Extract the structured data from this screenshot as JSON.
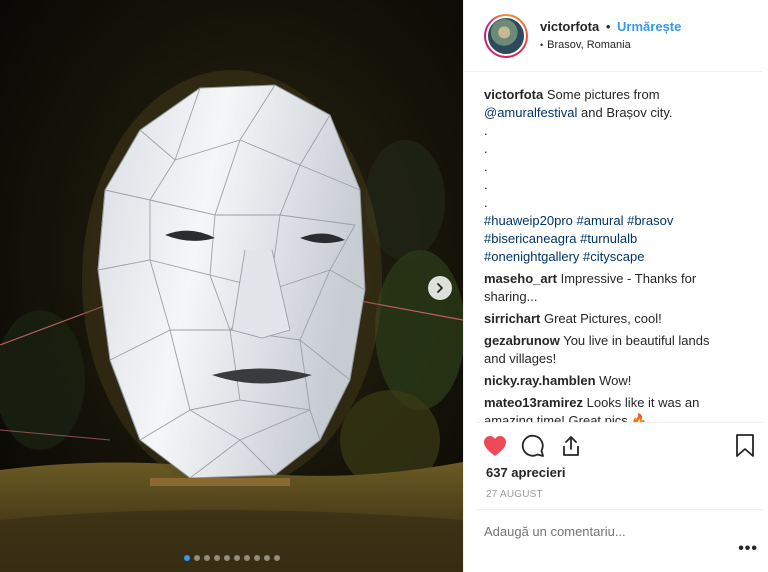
{
  "header": {
    "username": "victorfota",
    "separator": "•",
    "follow_label": "Urmărește",
    "location": "Brasov, Romania"
  },
  "caption": {
    "username": "victorfota",
    "text_before": " Some pictures from ",
    "mention": "@amuralfestival",
    "text_after": " and Brașov city.",
    "dots": [
      ".",
      ".",
      ".",
      ".",
      "."
    ],
    "hashtags_line1": "#huaweip20pro #amural #brasov",
    "hashtags_line2": "#bisericaneagra #turnulalb",
    "hashtags_line3": "#onenightgallery #cityscape"
  },
  "comments": [
    {
      "user": "maseho_art",
      "text": " Impressive - Thanks for sharing..."
    },
    {
      "user": "sirrichart",
      "text": " Great Pictures, cool!"
    },
    {
      "user": "gezabrunow",
      "text": " You live in beautiful lands and villages!"
    },
    {
      "user": "nicky.ray.hamblen",
      "text": " Wow!"
    },
    {
      "user": "mateo13ramirez",
      "text": " Looks like it was an amazing time! Great pics 🔥"
    }
  ],
  "actions": {
    "likes": "637 aprecieri",
    "date": "27 AUGUST",
    "liked": true,
    "like_color": "#ed4956"
  },
  "add_comment": {
    "placeholder": "Adaugă un comentariu...",
    "more": "•••"
  },
  "carousel": {
    "total": 10,
    "current": 1,
    "active_color": "#3897f0"
  },
  "icons": [
    "heart-icon",
    "comment-icon",
    "share-icon",
    "bookmark-icon",
    "chevron-right-icon",
    "location-pin-icon"
  ]
}
